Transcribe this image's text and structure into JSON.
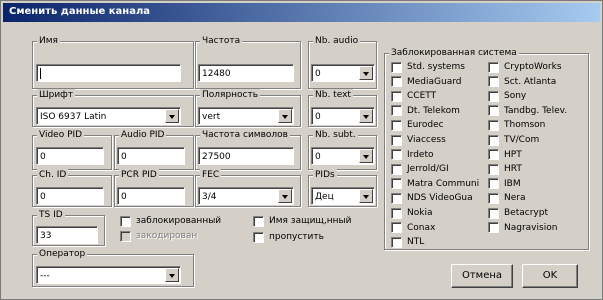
{
  "window": {
    "title": "Сменить данные канала"
  },
  "fields": {
    "name": {
      "label": "Имя",
      "value": ""
    },
    "frequency": {
      "label": "Частота",
      "value": "12480"
    },
    "nb_audio": {
      "label": "Nb. audio",
      "value": "0"
    },
    "font": {
      "label": "Шрифт",
      "value": "ISO 6937 Latin"
    },
    "polarity": {
      "label": "Полярность",
      "value": "vert"
    },
    "nb_text": {
      "label": "Nb. text",
      "value": "0"
    },
    "video_pid": {
      "label": "Video PID",
      "value": "0"
    },
    "audio_pid": {
      "label": "Audio PID",
      "value": "0"
    },
    "symbol_rate": {
      "label": "Частота символов",
      "value": "27500"
    },
    "nb_subt": {
      "label": "Nb. subt.",
      "value": "0"
    },
    "ch_id": {
      "label": "Ch. ID",
      "value": "0"
    },
    "pcr_pid": {
      "label": "PCR PID",
      "value": "0"
    },
    "fec": {
      "label": "FEC",
      "value": "3/4"
    },
    "pids": {
      "label": "PIDs",
      "value": "Дец"
    },
    "ts_id": {
      "label": "TS ID",
      "value": "33"
    },
    "operator": {
      "label": "Оператор",
      "value": "---"
    }
  },
  "flags": {
    "locked": "заблокированный",
    "encoded": "закодирован",
    "name_protected": "Имя защищ,нный",
    "skip": "пропустить"
  },
  "blocked_systems": {
    "label": "Заблокированная система",
    "col1": [
      "Std. systems",
      "MediaGuard",
      "CCETT",
      "Dt. Telekom",
      "Eurodec",
      "Viaccess",
      "Irdeto",
      "Jerrold/GI",
      "Matra Communi",
      "NDS VideoGua",
      "Nokia",
      "Conax",
      "NTL"
    ],
    "col2": [
      "CryptoWorks",
      "Sct. Atlanta",
      "Sony",
      "Tandbg. Telev.",
      "Thomson",
      "TV/Com",
      "HPT",
      "HRT",
      "IBM",
      "Nera",
      "Betacrypt",
      "Nagravision"
    ]
  },
  "buttons": {
    "cancel": "Отмена",
    "ok": "OK"
  }
}
